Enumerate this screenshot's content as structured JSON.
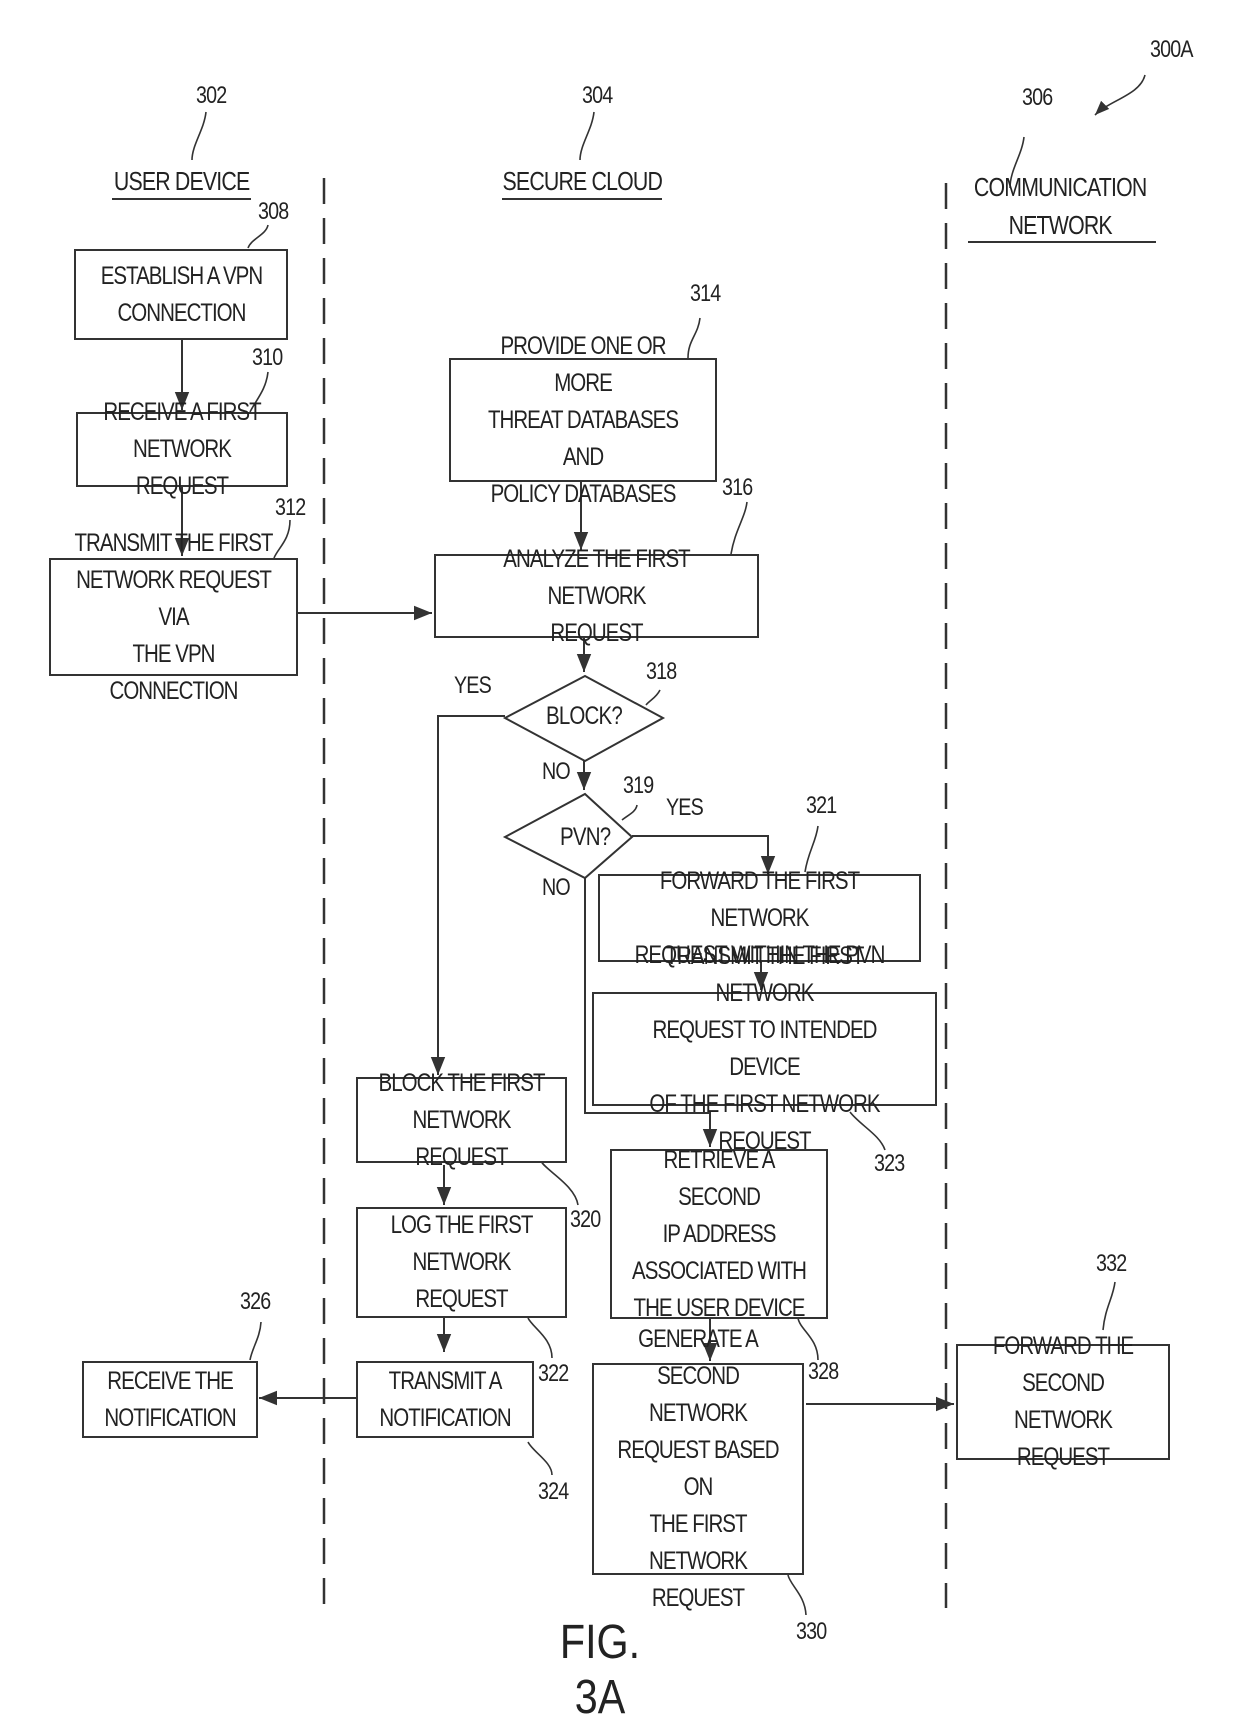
{
  "figure": {
    "ref": "300A",
    "caption": "FIG. 3A"
  },
  "lanes": [
    {
      "ref": "302",
      "title": "USER DEVICE"
    },
    {
      "ref": "304",
      "title": "SECURE CLOUD"
    },
    {
      "ref": "306",
      "title": "COMMUNICATION\nNETWORK"
    }
  ],
  "steps": {
    "s308": {
      "ref": "308",
      "text": "ESTABLISH A VPN\nCONNECTION"
    },
    "s310": {
      "ref": "310",
      "text": "RECEIVE A FIRST\nNETWORK REQUEST"
    },
    "s312": {
      "ref": "312",
      "text": "TRANSMIT THE FIRST\nNETWORK REQUEST VIA\nTHE VPN CONNECTION"
    },
    "s314": {
      "ref": "314",
      "text": "PROVIDE ONE OR MORE\nTHREAT DATABASES AND\nPOLICY DATABASES"
    },
    "s316": {
      "ref": "316",
      "text": "ANALYZE THE FIRST NETWORK\nREQUEST"
    },
    "s318": {
      "ref": "318",
      "text": "BLOCK?"
    },
    "s319": {
      "ref": "319",
      "text": "PVN?"
    },
    "s320": {
      "ref": "320",
      "text": "BLOCK THE FIRST\nNETWORK REQUEST"
    },
    "s321": {
      "ref": "321",
      "text": "FORWARD THE FIRST NETWORK\nREQUEST WITHIN THE PVN"
    },
    "s322": {
      "ref": "322",
      "text": "LOG THE FIRST\nNETWORK REQUEST"
    },
    "s323": {
      "ref": "323",
      "text": "TRANSMIT THE FIRST NETWORK\nREQUEST TO INTENDED DEVICE\nOF THE FIRST NETWORK REQUEST"
    },
    "s324": {
      "ref": "324",
      "text": "TRANSMIT A\nNOTIFICATION"
    },
    "s326": {
      "ref": "326",
      "text": "RECEIVE THE\nNOTIFICATION"
    },
    "s328": {
      "ref": "328",
      "text": "RETRIEVE A SECOND\nIP ADDRESS\nASSOCIATED WITH\nTHE USER DEVICE"
    },
    "s330": {
      "ref": "330",
      "text": "GENERATE A\nSECOND NETWORK\nREQUEST BASED ON\nTHE FIRST NETWORK\nREQUEST"
    },
    "s332": {
      "ref": "332",
      "text": "FORWARD THE\nSECOND NETWORK\nREQUEST"
    }
  },
  "branch_labels": {
    "block_yes": "YES",
    "block_no": "NO",
    "pvn_yes": "YES",
    "pvn_no": "NO"
  }
}
